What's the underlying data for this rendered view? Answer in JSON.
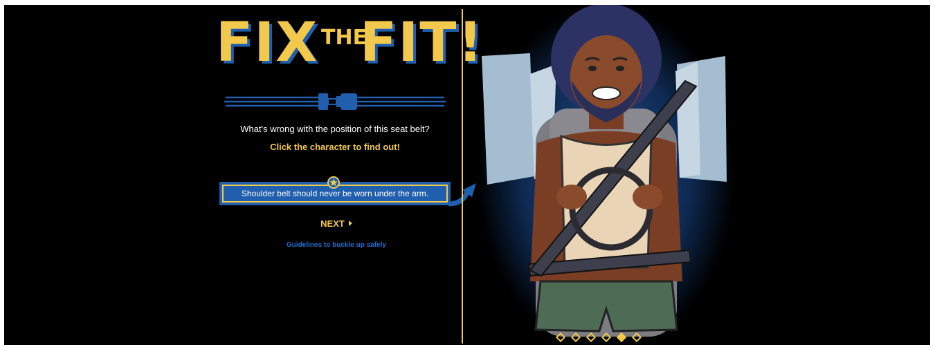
{
  "logo": {
    "word1": "FIX",
    "word2": "THE",
    "word3": "FIT!"
  },
  "question": "What's wrong with the position of this seat belt?",
  "hint": "Click the character to find out!",
  "feedback": {
    "text": "Shoulder belt should never be worn under the arm.",
    "icon": "star-icon"
  },
  "next": {
    "label": "NEXT",
    "icon": "triangle-right-icon"
  },
  "guidelines_link": "Guidelines to buckle up safely",
  "slides": {
    "total": 6,
    "active_index": 4
  },
  "colors": {
    "background": "#000000",
    "accent_yellow": "#f3c94c",
    "accent_blue": "#1f5fae",
    "link_blue": "#1f6fd0"
  }
}
